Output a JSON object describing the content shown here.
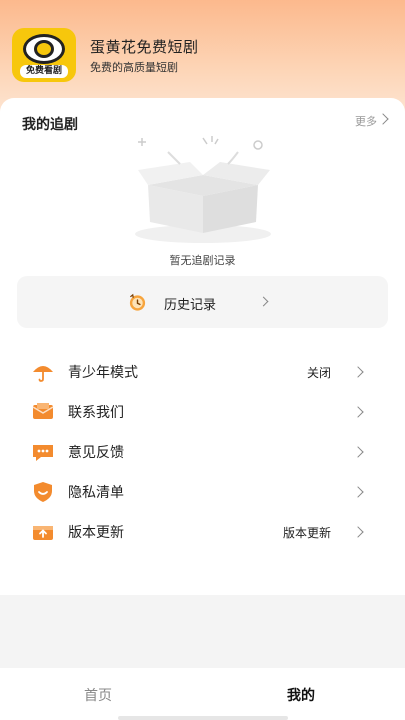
{
  "app": {
    "logo_text": "免费看剧",
    "title": "蛋黄花免费短剧",
    "subtitle": "免费的高质量短剧"
  },
  "watching": {
    "title": "我的追剧",
    "more_label": "更多",
    "empty_text": "暂无追剧记录"
  },
  "history": {
    "label": "历史记录"
  },
  "menu": {
    "items": [
      {
        "label": "青少年模式",
        "value": "关闭",
        "icon": "umbrella-icon"
      },
      {
        "label": "联系我们",
        "value": "",
        "icon": "mail-icon"
      },
      {
        "label": "意见反馈",
        "value": "",
        "icon": "chat-icon"
      },
      {
        "label": "隐私清单",
        "value": "",
        "icon": "shield-icon"
      },
      {
        "label": "版本更新",
        "value": "版本更新",
        "icon": "upload-box-icon"
      }
    ]
  },
  "tabbar": {
    "home": "首页",
    "mine": "我的"
  },
  "colors": {
    "accent_orange": "#f38b2e",
    "brand_yellow": "#f7c70c"
  }
}
